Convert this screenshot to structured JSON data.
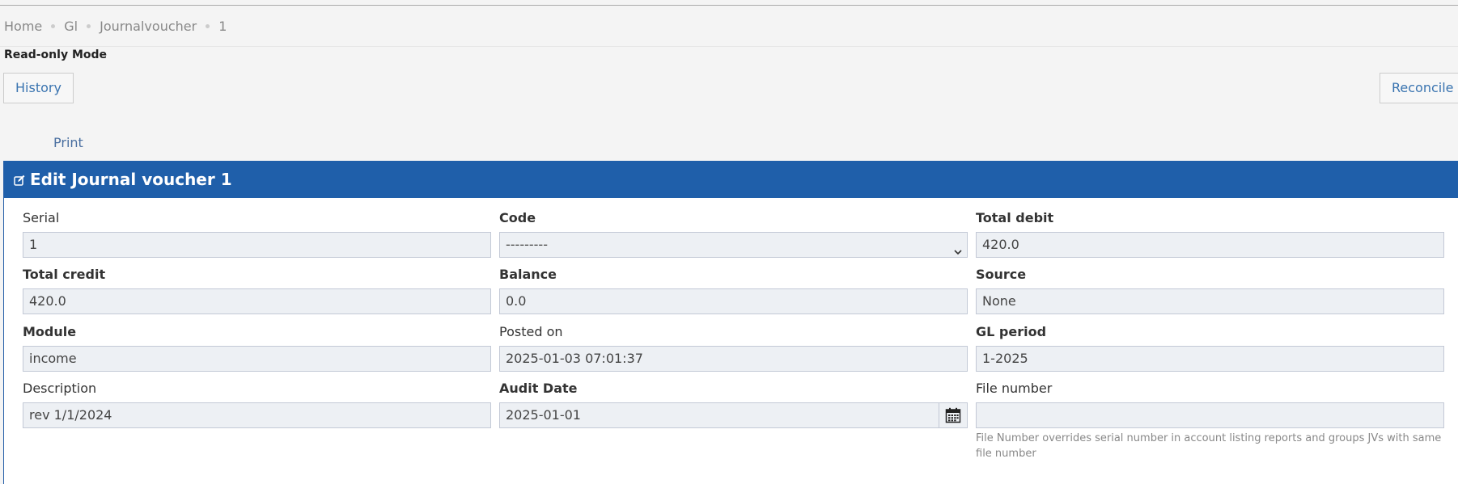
{
  "breadcrumb": [
    "Home",
    "Gl",
    "Journalvoucher",
    "1"
  ],
  "mode_label": "Read-only Mode",
  "buttons": {
    "history": "History",
    "reconcile": "Reconcile"
  },
  "print_label": "Print",
  "panel": {
    "title": "Edit Journal voucher 1",
    "header_color": "#1f5faa"
  },
  "fields": {
    "serial": {
      "label": "Serial",
      "value": "1"
    },
    "code": {
      "label": "Code",
      "value": "---------"
    },
    "total_debit": {
      "label": "Total debit",
      "value": "420.0"
    },
    "total_credit": {
      "label": "Total credit",
      "value": "420.0"
    },
    "balance": {
      "label": "Balance",
      "value": "0.0"
    },
    "source": {
      "label": "Source",
      "value": "None"
    },
    "module": {
      "label": "Module",
      "value": "income"
    },
    "posted_on": {
      "label": "Posted on",
      "value": "2025-01-03 07:01:37"
    },
    "gl_period": {
      "label": "GL period",
      "value": "1-2025"
    },
    "description": {
      "label": "Description",
      "value": "rev 1/1/2024"
    },
    "audit_date": {
      "label": "Audit Date",
      "value": "2025-01-01"
    },
    "file_number": {
      "label": "File number",
      "value": "",
      "help": "File Number overrides serial number in account listing reports and groups JVs with same file number"
    }
  }
}
